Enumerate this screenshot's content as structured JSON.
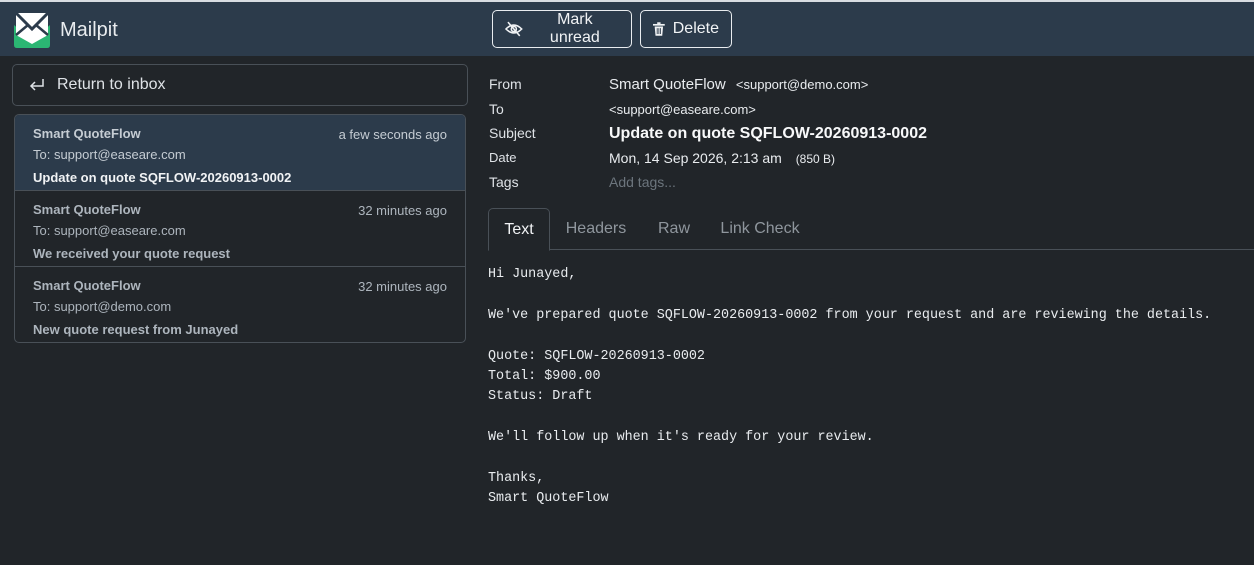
{
  "app": {
    "name": "Mailpit"
  },
  "toolbar": {
    "mark_unread_label": "Mark unread",
    "delete_label": "Delete"
  },
  "sidebar": {
    "return_label": "Return to inbox",
    "messages": [
      {
        "from": "Smart QuoteFlow",
        "time": "a few seconds ago",
        "to": "To: support@easeare.com",
        "subject": "Update on quote SQFLOW-20260913-0002"
      },
      {
        "from": "Smart QuoteFlow",
        "time": "32 minutes ago",
        "to": "To: support@easeare.com",
        "subject": "We received your quote request"
      },
      {
        "from": "Smart QuoteFlow",
        "time": "32 minutes ago",
        "to": "To: support@demo.com",
        "subject": "New quote request from Junayed"
      }
    ]
  },
  "message": {
    "labels": {
      "from": "From",
      "to": "To",
      "subject": "Subject",
      "date": "Date",
      "tags": "Tags"
    },
    "from_name": "Smart QuoteFlow",
    "from_email": "<support@demo.com>",
    "to": "<support@easeare.com>",
    "subject": "Update on quote SQFLOW-20260913-0002",
    "date": "Mon, 14 Sep 2026, 2:13 am",
    "size": "(850 B)",
    "tags_placeholder": "Add tags...",
    "tabs": [
      "Text",
      "Headers",
      "Raw",
      "Link Check"
    ],
    "body": "Hi Junayed,\n\nWe've prepared quote SQFLOW-20260913-0002 from your request and are reviewing the details.\n\nQuote: SQFLOW-20260913-0002\nTotal: $900.00\nStatus: Draft\n\nWe'll follow up when it's ready for your review.\n\nThanks,\nSmart QuoteFlow"
  },
  "colors": {
    "topbar": "#2c3b4b",
    "background": "#212529",
    "brand_green": "#2bb673"
  },
  "icons": {
    "logo": "mailpit-logo-icon",
    "mark_unread": "eye-slash-icon",
    "delete": "trash-icon",
    "return": "return-arrow-icon"
  }
}
